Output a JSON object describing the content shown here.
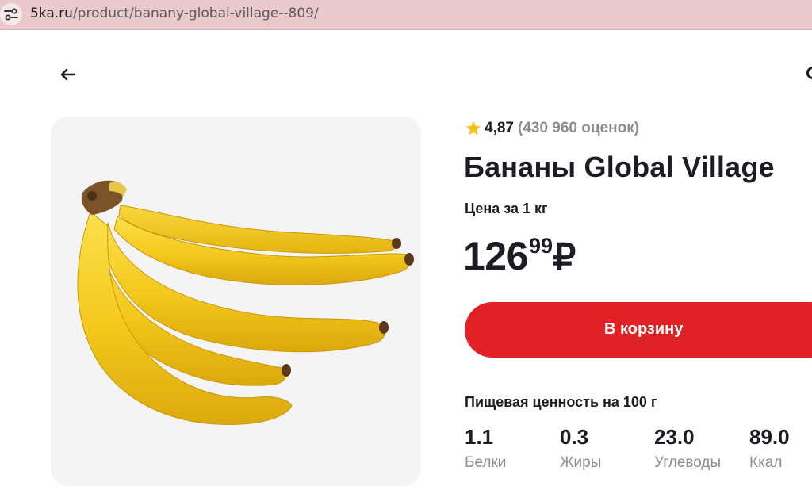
{
  "browser": {
    "url_domain": "5ka.ru",
    "url_path": "/product/banany-global-village--809/"
  },
  "product": {
    "image_alt": "Бананы Global Village",
    "rating": {
      "score": "4,87",
      "count_text": "(430 960 оценок)"
    },
    "title": "Бананы Global Village",
    "price_label": "Цена за 1 кг",
    "price": {
      "rubles": "126",
      "kopecks": "99",
      "currency": "₽"
    },
    "cart_button_label": "В корзину",
    "nutrition": {
      "title": "Пищевая ценность на 100 г",
      "items": [
        {
          "value": "1.1",
          "label": "Белки"
        },
        {
          "value": "0.3",
          "label": "Жиры"
        },
        {
          "value": "23.0",
          "label": "Углеводы"
        },
        {
          "value": "89.0",
          "label": "Ккал"
        }
      ]
    }
  },
  "colors": {
    "accent_red": "#e02125",
    "star_yellow": "#f7c11b",
    "text_dark": "#1c1c24",
    "text_muted": "#8e8e8e",
    "addressbar": "#e9c9cc"
  },
  "icons": {
    "site_info": "tune-icon",
    "back": "arrow-left-icon",
    "rating": "star-icon"
  }
}
